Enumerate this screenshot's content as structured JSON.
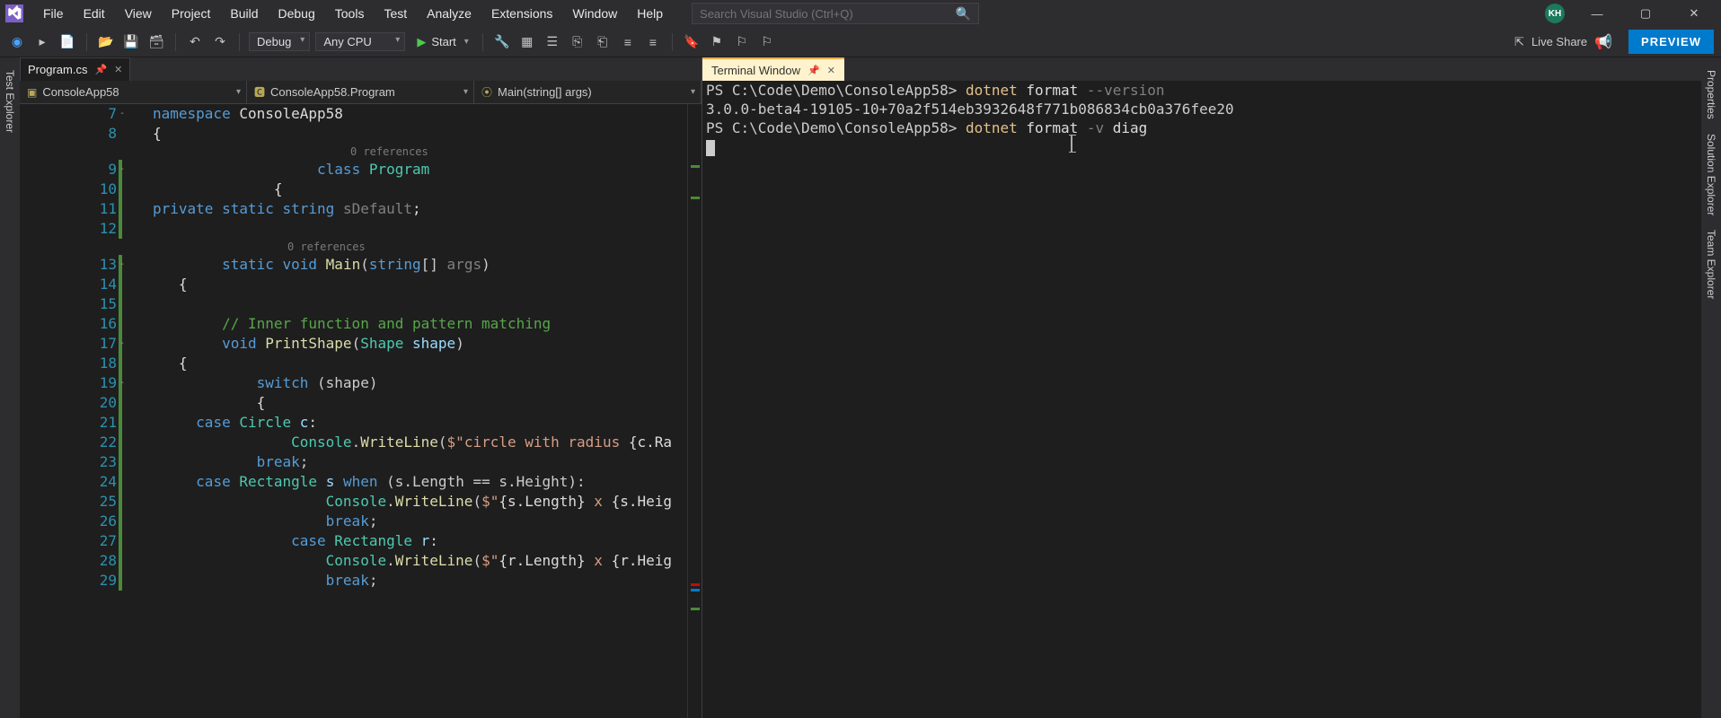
{
  "menu": [
    "File",
    "Edit",
    "View",
    "Project",
    "Build",
    "Debug",
    "Tools",
    "Test",
    "Analyze",
    "Extensions",
    "Window",
    "Help"
  ],
  "search": {
    "placeholder": "Search Visual Studio (Ctrl+Q)"
  },
  "avatar": "KH",
  "toolbar": {
    "config": "Debug",
    "platform": "Any CPU",
    "start": "Start",
    "liveshare": "Live Share",
    "preview": "PREVIEW"
  },
  "leftRail": [
    "Test Explorer"
  ],
  "rightRail": [
    "Properties",
    "Solution Explorer",
    "Team Explorer"
  ],
  "editor": {
    "tab": {
      "name": "Program.cs"
    },
    "nav": {
      "project": "ConsoleApp58",
      "class": "ConsoleApp58.Program",
      "member": "Main(string[] args)"
    },
    "lines": [
      {
        "n": 7,
        "fold": "-",
        "bar": false,
        "html": "<span class='kw'>namespace</span> <span class='id'>ConsoleApp58</span>"
      },
      {
        "n": 8,
        "fold": "",
        "bar": false,
        "html": "<span class='pu'>{</span>"
      },
      {
        "ref": true,
        "cls": "ref",
        "text": "0 references"
      },
      {
        "n": 9,
        "fold": "-",
        "bar": true,
        "html": "                   <span class='kw'>class</span> <span class='cls'>Program</span>"
      },
      {
        "n": 10,
        "fold": "",
        "bar": true,
        "html": "              <span class='pu'>{</span>"
      },
      {
        "n": 11,
        "fold": "",
        "bar": true,
        "html": "<span class='kw'>private</span> <span class='kw'>static</span> <span class='kw'>string</span> <span class='dim'>sDefault</span><span class='pu'>;</span>"
      },
      {
        "n": 12,
        "fold": "",
        "bar": true,
        "html": ""
      },
      {
        "ref": true,
        "cls": "ref ref2",
        "text": "0 references"
      },
      {
        "n": 13,
        "fold": "-",
        "bar": true,
        "html": "        <span class='kw'>static</span> <span class='kw'>void</span> <span class='fn'>Main</span>(<span class='kw'>string</span>[] <span class='dim'>args</span>)"
      },
      {
        "n": 14,
        "fold": "",
        "bar": true,
        "html": "   <span class='pu'>{</span>"
      },
      {
        "n": 15,
        "fold": "",
        "bar": true,
        "html": ""
      },
      {
        "n": 16,
        "fold": "",
        "bar": true,
        "html": "        <span class='cmt'>// Inner function and pattern matching</span>"
      },
      {
        "n": 17,
        "fold": "-",
        "bar": true,
        "html": "        <span class='kw'>void</span> <span class='fn'>PrintShape</span>(<span class='cls'>Shape</span> <span class='param'>shape</span>)"
      },
      {
        "n": 18,
        "fold": "",
        "bar": true,
        "html": "   <span class='pu'>{</span>"
      },
      {
        "n": 19,
        "fold": "-",
        "bar": true,
        "html": "            <span class='kw'>switch</span> (shape)"
      },
      {
        "n": 20,
        "fold": "",
        "bar": true,
        "html": "            <span class='pu'>{</span>"
      },
      {
        "n": 21,
        "fold": "",
        "bar": true,
        "html": "     <span class='kw'>case</span> <span class='cls'>Circle</span> <span class='param'>c</span>:"
      },
      {
        "n": 22,
        "fold": "",
        "bar": true,
        "html": "                <span class='cls'>Console</span>.<span class='fn'>WriteLine</span>(<span class='str'>$\"circle with radius </span><span class='pu'>{c.Ra</span>"
      },
      {
        "n": 23,
        "fold": "",
        "bar": true,
        "html": "            <span class='kw'>break</span>;"
      },
      {
        "n": 24,
        "fold": "",
        "bar": true,
        "html": "     <span class='kw'>case</span> <span class='cls'>Rectangle</span> <span class='param'>s</span> <span class='kw'>when</span> (s.Length == s.Height):"
      },
      {
        "n": 25,
        "fold": "",
        "bar": true,
        "html": "                    <span class='cls'>Console</span>.<span class='fn'>WriteLine</span>(<span class='str'>$\"</span><span class='pu'>{s.Length}</span><span class='str'> x </span><span class='pu'>{s.Heig</span>"
      },
      {
        "n": 26,
        "fold": "",
        "bar": true,
        "html": "                    <span class='kw'>break</span>;"
      },
      {
        "n": 27,
        "fold": "",
        "bar": true,
        "html": "                <span class='kw'>case</span> <span class='cls'>Rectangle</span> <span class='param'>r</span>:"
      },
      {
        "n": 28,
        "fold": "",
        "bar": true,
        "html": "                    <span class='cls'>Console</span>.<span class='fn'>WriteLine</span>(<span class='str'>$\"</span><span class='pu'>{r.Length}</span><span class='str'> x </span><span class='pu'>{r.Heig</span>"
      },
      {
        "n": 29,
        "fold": "",
        "bar": true,
        "html": "                    <span class='kw'>break</span>;"
      }
    ]
  },
  "terminal": {
    "tab": "Terminal Window",
    "lines": [
      {
        "html": "<span class='ps-path'>PS C:\\Code\\Demo\\ConsoleApp58&gt; </span><span class='ps-cmd'>dotnet</span> <span class='pl'>format</span> <span class='ps-arg'>--version</span>"
      },
      {
        "html": "<span class='ps-out'>3.0.0-beta4-19105-10+70a2f514eb3932648f771b086834cb0a376fee20</span>"
      },
      {
        "html": "<span class='ps-path'>PS C:\\Code\\Demo\\ConsoleApp58&gt; </span><span class='ps-cmd'>dotnet</span> <span class='pl'>format</span> <span class='ps-arg'>-v</span> <span class='pl'>diag</span>"
      },
      {
        "html": "<span class='cursor-blink'></span>"
      }
    ]
  }
}
